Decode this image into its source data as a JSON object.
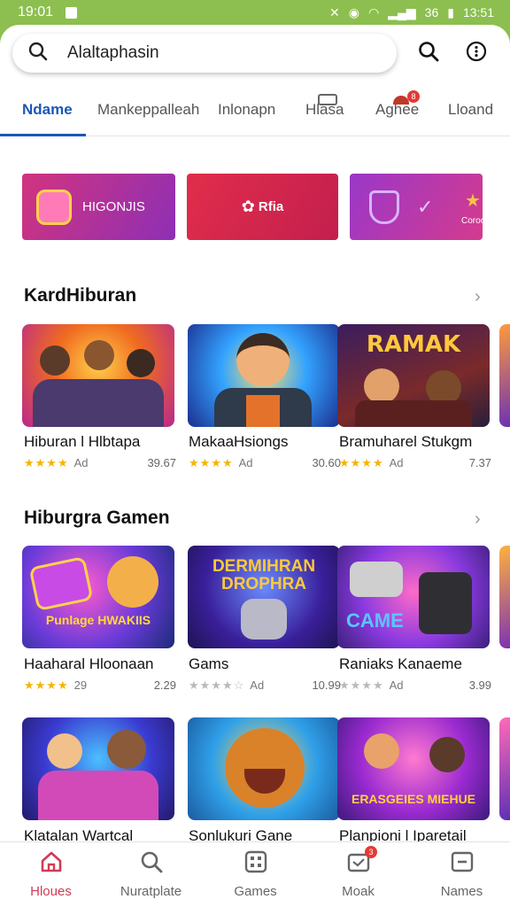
{
  "status": {
    "time_left": "19:01",
    "time_right": "13:51",
    "signal": "36"
  },
  "search": {
    "text": "Alaltaphasin"
  },
  "tabs": [
    {
      "label": "Ndame",
      "active": true
    },
    {
      "label": "Mankeppalleah"
    },
    {
      "label": "Inlonapn"
    },
    {
      "label": "Hlasa"
    },
    {
      "label": "Aghee",
      "badge": "8"
    },
    {
      "label": "Lloand"
    }
  ],
  "banners": [
    {
      "label": "HIGONJIS"
    },
    {
      "label": "Rfia"
    },
    {
      "label": "Coroou"
    }
  ],
  "sections": [
    {
      "title": "KardHiburan",
      "cards": [
        {
          "title": "Hiburan l Hlbtapa",
          "rating": "Ad",
          "count": "39.67",
          "image": "group-adventure-heroes"
        },
        {
          "title": "MakaaHsiongs",
          "rating": "Ad",
          "count": "30.60",
          "image": "cheering-boy"
        },
        {
          "title": "Bramuharel Stukgm",
          "rating": "Ad",
          "count": "7.37",
          "image": "ramak-arcade"
        }
      ]
    },
    {
      "title": "Hiburgra Gamen",
      "cards": [
        {
          "title": "Haaharal Hloonaan",
          "rating": "29",
          "count": "2.29",
          "image": "purple-controller-bear"
        },
        {
          "title": "Gams",
          "rating": "Ad",
          "count": "10.99",
          "image": "dermihran-droid"
        },
        {
          "title": "Raniaks Kanaeme",
          "rating": "Ad",
          "count": "3.99",
          "image": "game-controllers"
        }
      ]
    },
    {
      "cards": [
        {
          "title": "Klatalan Wartcal",
          "image": "magic-adventurers"
        },
        {
          "title": "Sonlukuri Gane",
          "image": "happy-bear"
        },
        {
          "title": "Planpioni l Iparetail",
          "image": "badges-kids"
        }
      ]
    }
  ],
  "bottom_nav": [
    {
      "label": "Hloues",
      "active": true,
      "icon": "home-icon"
    },
    {
      "label": "Nuratplate",
      "icon": "search-icon"
    },
    {
      "label": "Games",
      "icon": "games-grid-icon"
    },
    {
      "label": "Moak",
      "icon": "inbox-icon",
      "badge": "3"
    },
    {
      "label": "Names",
      "icon": "minus-box-icon"
    }
  ],
  "colors": {
    "accent": "#1a57b8",
    "nav_active": "#d23a57",
    "topbar": "#8cbf4f",
    "star": "#f5b400"
  }
}
